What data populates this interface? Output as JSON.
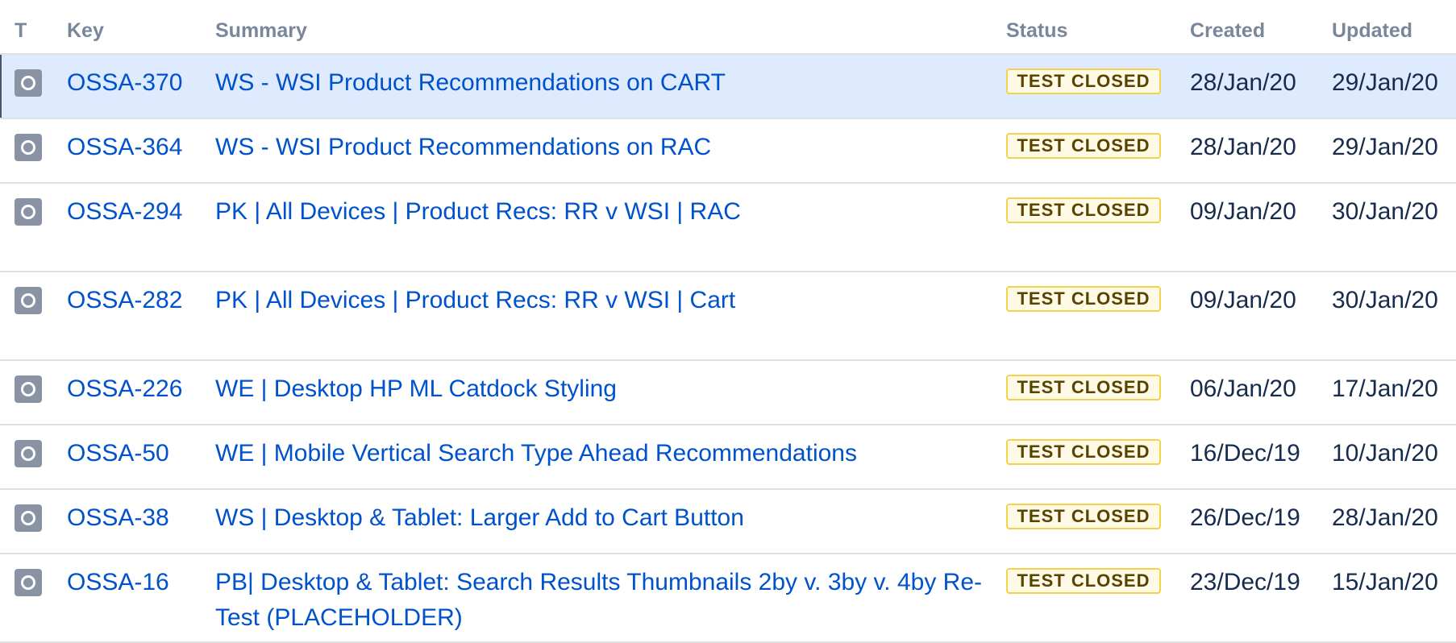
{
  "columns": {
    "type": "T",
    "key": "Key",
    "summary": "Summary",
    "status": "Status",
    "created": "Created",
    "updated": "Updated"
  },
  "issues": [
    {
      "key": "OSSA-370",
      "summary": "WS - WSI Product Recommendations on CART",
      "status": "TEST CLOSED",
      "created": "28/Jan/20",
      "updated": "29/Jan/20",
      "selected": true
    },
    {
      "key": "OSSA-364",
      "summary": "WS - WSI Product Recommendations on RAC",
      "status": "TEST CLOSED",
      "created": "28/Jan/20",
      "updated": "29/Jan/20"
    },
    {
      "key": "OSSA-294",
      "summary": "PK | All Devices | Product Recs: RR v WSI | RAC",
      "status": "TEST CLOSED",
      "created": "09/Jan/20",
      "updated": "30/Jan/20"
    },
    {
      "key": "OSSA-282",
      "summary": "PK | All Devices | Product Recs: RR v WSI | Cart",
      "status": "TEST CLOSED",
      "created": "09/Jan/20",
      "updated": "30/Jan/20"
    },
    {
      "key": "OSSA-226",
      "summary": "WE | Desktop HP ML Catdock Styling",
      "status": "TEST CLOSED",
      "created": "06/Jan/20",
      "updated": "17/Jan/20"
    },
    {
      "key": "OSSA-50",
      "summary": "WE | Mobile Vertical Search Type Ahead Recommendations",
      "status": "TEST CLOSED",
      "created": "16/Dec/19",
      "updated": "10/Jan/20"
    },
    {
      "key": "OSSA-38",
      "summary": "WS | Desktop & Tablet: Larger Add to Cart Button",
      "status": "TEST CLOSED",
      "created": "26/Dec/19",
      "updated": "28/Jan/20"
    },
    {
      "key": "OSSA-16",
      "summary": "PB| Desktop & Tablet: Search Results Thumbnails 2by v. 3by v. 4by Re-Test (PLACEHOLDER)",
      "status": "TEST CLOSED",
      "created": "23/Dec/19",
      "updated": "15/Jan/20"
    }
  ],
  "colors": {
    "link": "#0052cc",
    "selected_row": "#deebff",
    "status_border": "#f4d34a",
    "status_text": "#594300",
    "type_icon": "#8993a4"
  },
  "icons": {
    "type": "task-type-icon"
  }
}
